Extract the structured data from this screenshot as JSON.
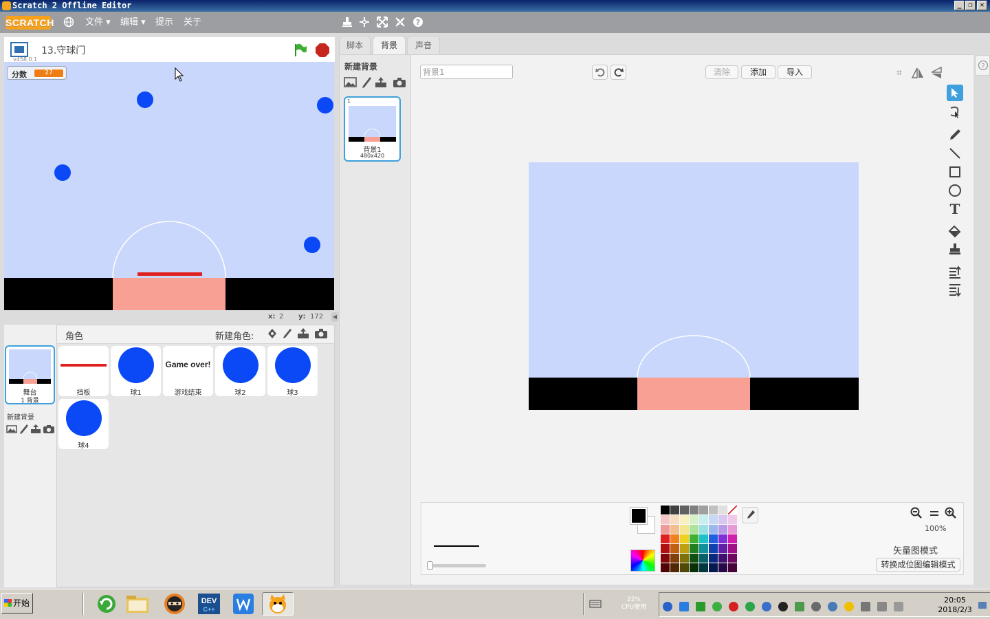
{
  "window": {
    "title": "Scratch 2 Offline Editor",
    "controls": [
      "_",
      "❐",
      "✕"
    ]
  },
  "menubar": {
    "logo": "SCRATCH",
    "file": "文件 ▾",
    "edit": "编辑 ▾",
    "tips": "提示",
    "about": "关于"
  },
  "stage": {
    "project_name": "13.守球门",
    "version": "v458.0.1",
    "variable_label": "分数",
    "variable_value": "27",
    "x_label": "x:",
    "x_value": "2",
    "y_label": "y:",
    "y_value": "172"
  },
  "sprites": {
    "header": "角色",
    "new_sprite_label": "新建角色:",
    "stage_label": "舞台",
    "stage_sublabel": "1 背景",
    "new_backdrop_label": "新建背景",
    "items": [
      {
        "name": "挡板"
      },
      {
        "name": "球1"
      },
      {
        "name": "游戏结束",
        "preview_text": "Game over!"
      },
      {
        "name": "球2"
      },
      {
        "name": "球3"
      },
      {
        "name": "球4"
      }
    ]
  },
  "tabs": {
    "scripts": "脚本",
    "backdrops": "背景",
    "sounds": "声音"
  },
  "backdrops": {
    "new_backdrop": "新建背景",
    "items": [
      {
        "index": "1",
        "name": "背景1",
        "size": "480x420"
      }
    ]
  },
  "paint": {
    "name_value": "背景1",
    "clear": "清除",
    "add": "添加",
    "import": "导入",
    "zoom": "100%",
    "mode": "矢量图模式",
    "convert": "转换成位图编辑模式"
  },
  "taskbar": {
    "start": "开始",
    "cpu_value": "22%",
    "cpu_label": "CPU使用",
    "time": "20:05",
    "date": "2018/2/3"
  },
  "colors": {
    "stage_bg": "#c8d7fb",
    "goal_bg": "#f9a095",
    "ball": "#0a49f5",
    "paddle": "#e0201e",
    "selection": "#3ea0dc"
  }
}
